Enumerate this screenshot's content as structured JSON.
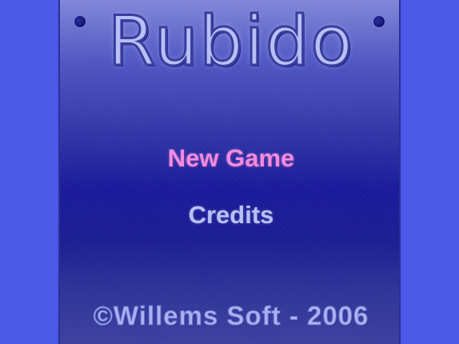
{
  "game": {
    "title": "Rubido"
  },
  "menu": {
    "items": [
      {
        "label": "New Game",
        "selected": true,
        "color": "#f08ce2"
      },
      {
        "label": "Credits",
        "selected": false,
        "color": "#b8c1f7"
      }
    ]
  },
  "footer": {
    "copyright": "©Willems Soft - 2006"
  },
  "colors": {
    "background": "#4b58e8",
    "panel_top": "#7f86d8",
    "panel_mid": "#18189a",
    "title": "#b8c0f6"
  },
  "icons": [
    "decorative-corner-dot-left",
    "decorative-corner-dot-right"
  ]
}
